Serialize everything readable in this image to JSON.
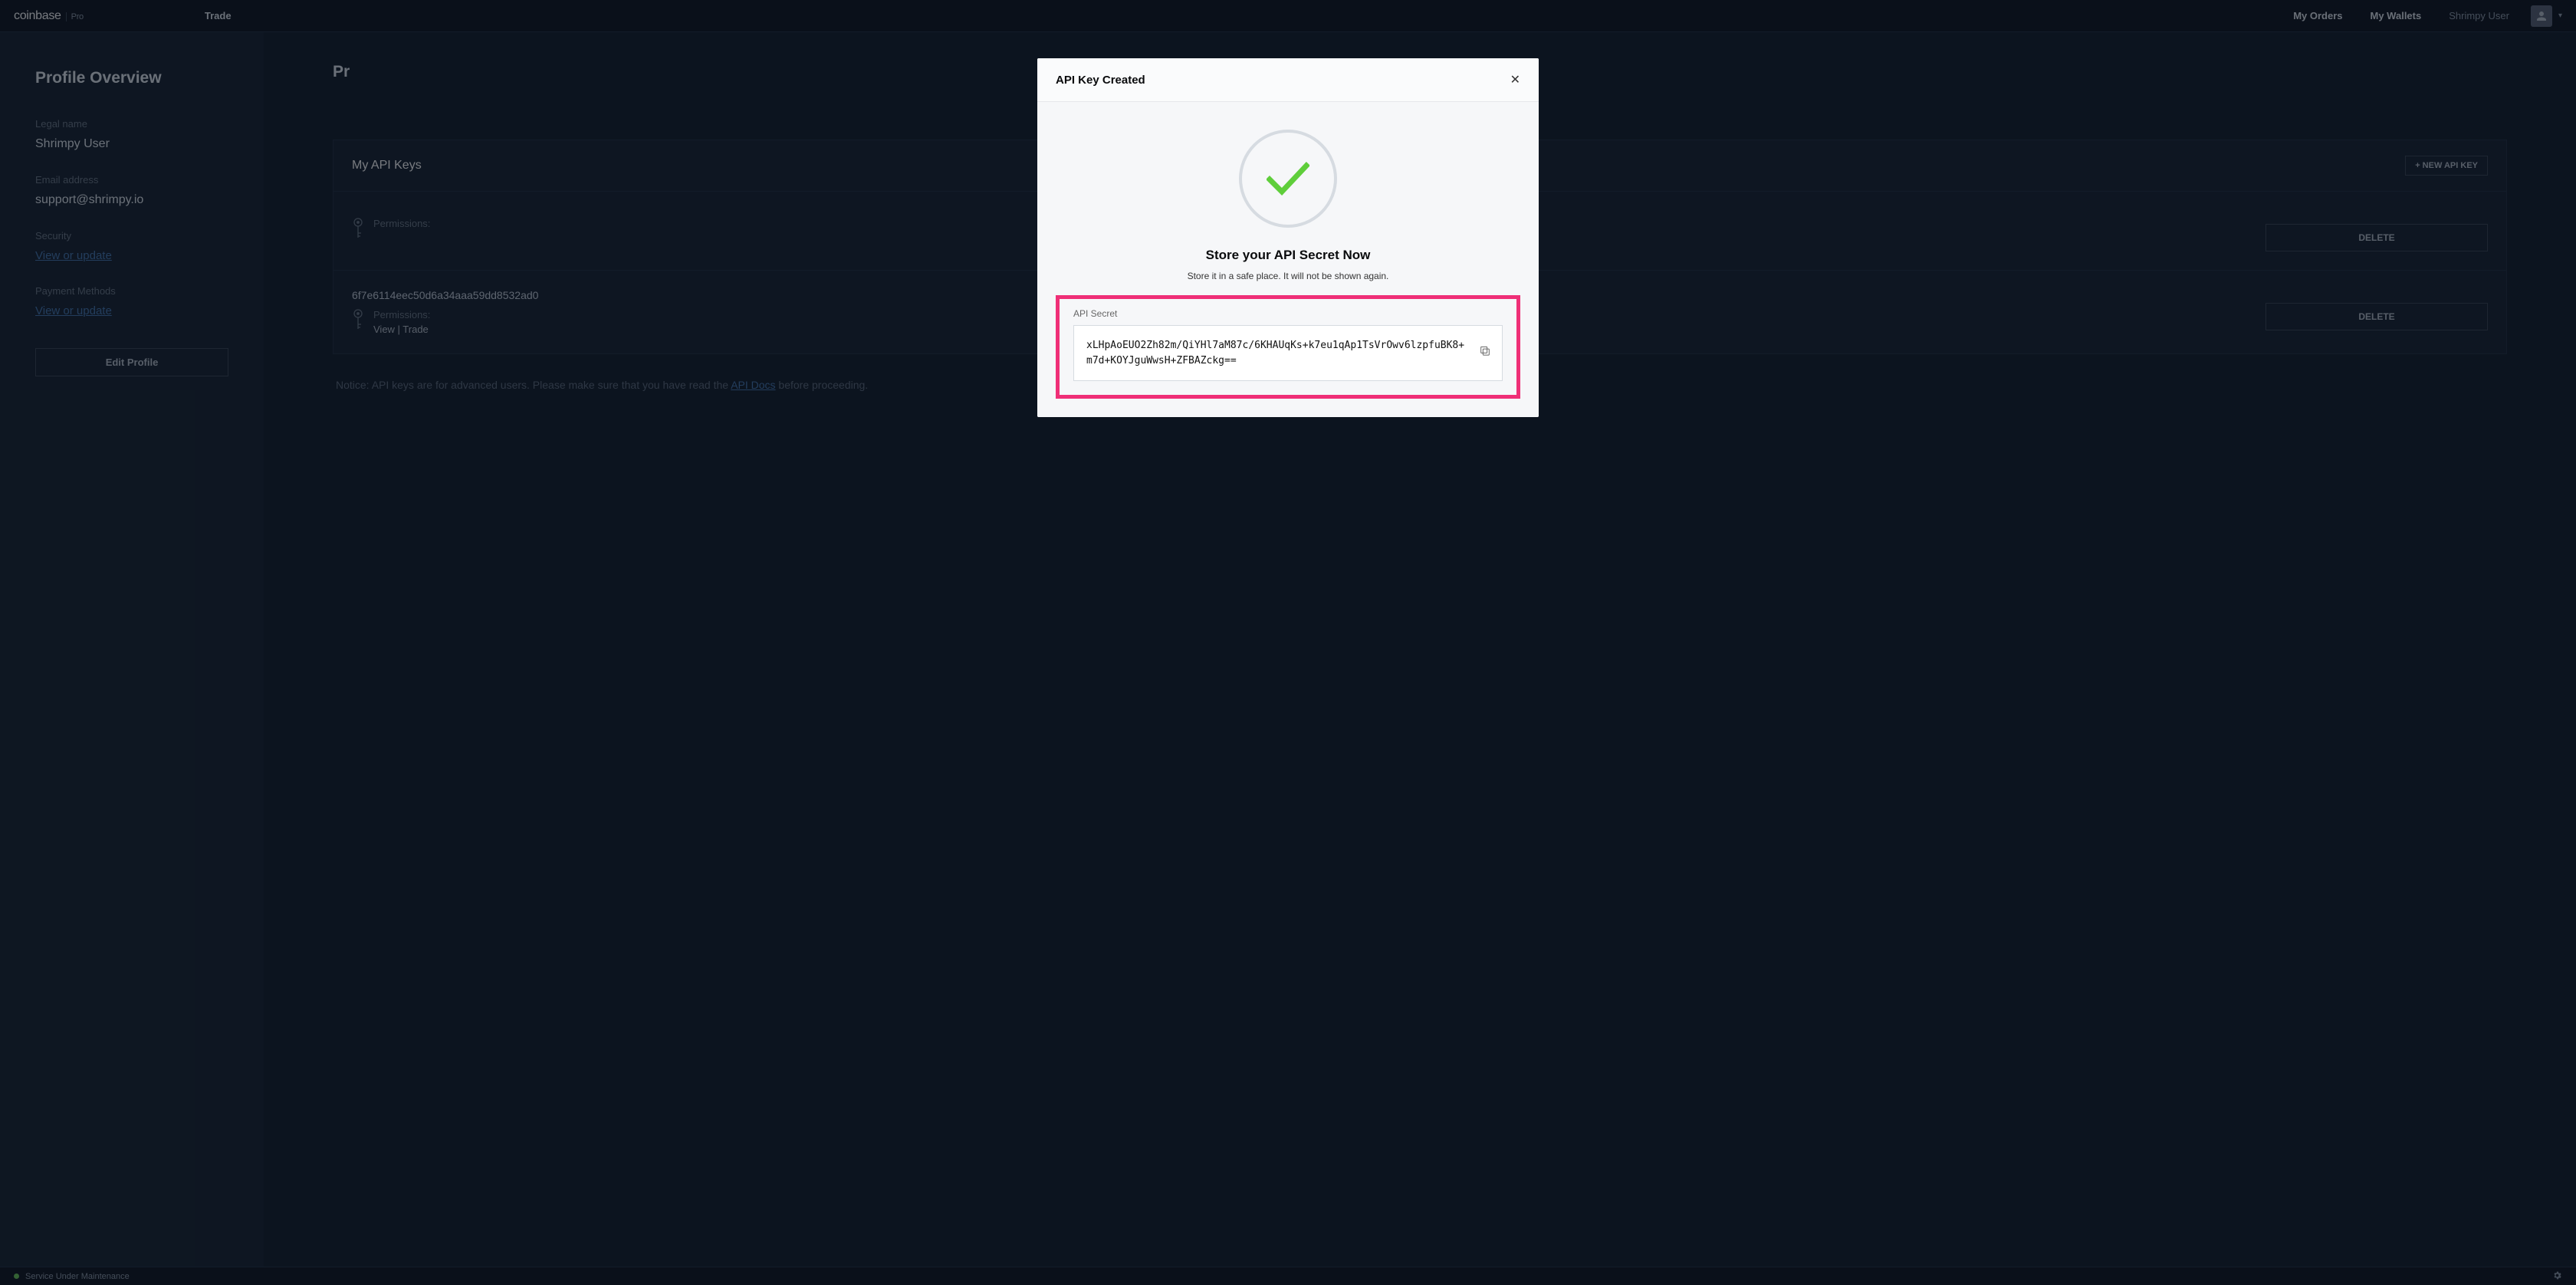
{
  "topnav": {
    "logo_main": "coinbase",
    "logo_sub": "Pro",
    "trade": "Trade",
    "my_orders": "My Orders",
    "my_wallets": "My Wallets",
    "user": "Shrimpy User"
  },
  "sidebar": {
    "page_title": "Profile Overview",
    "legal_name_label": "Legal name",
    "legal_name_value": "Shrimpy User",
    "email_label": "Email address",
    "email_value": "support@shrimpy.io",
    "security_label": "Security",
    "security_link": "View or update",
    "payment_label": "Payment Methods",
    "payment_link": "View or update",
    "edit_profile": "Edit Profile"
  },
  "content": {
    "page_title_visible_prefix": "Pr",
    "api_panel_title": "My API Keys",
    "new_api_key": "+ NEW API KEY",
    "keys": [
      {
        "id": "",
        "perm_label": "Permissions:",
        "perm_value": "",
        "delete": "DELETE"
      },
      {
        "id": "6f7e6114eec50d6a34aaa59dd8532ad0",
        "perm_label": "Permissions:",
        "perm_value": "View | Trade",
        "delete": "DELETE"
      }
    ],
    "notice_pre": "Notice: API keys are for advanced users. Please make sure that you have read the ",
    "notice_link": "API Docs",
    "notice_post": " before proceeding."
  },
  "modal": {
    "title": "API Key Created",
    "headline": "Store your API Secret Now",
    "sub": "Store it in a safe place. It will not be shown again.",
    "secret_label": "API Secret",
    "secret_value": "xLHpAoEUO2Zh82m/QiYHl7aM87c/6KHAUqKs+k7eu1qAp1TsVrOwv6lzpfuBK8+m7d+KOYJguWwsH+ZFBAZckg=="
  },
  "footer": {
    "status": "Service Under Maintenance"
  }
}
